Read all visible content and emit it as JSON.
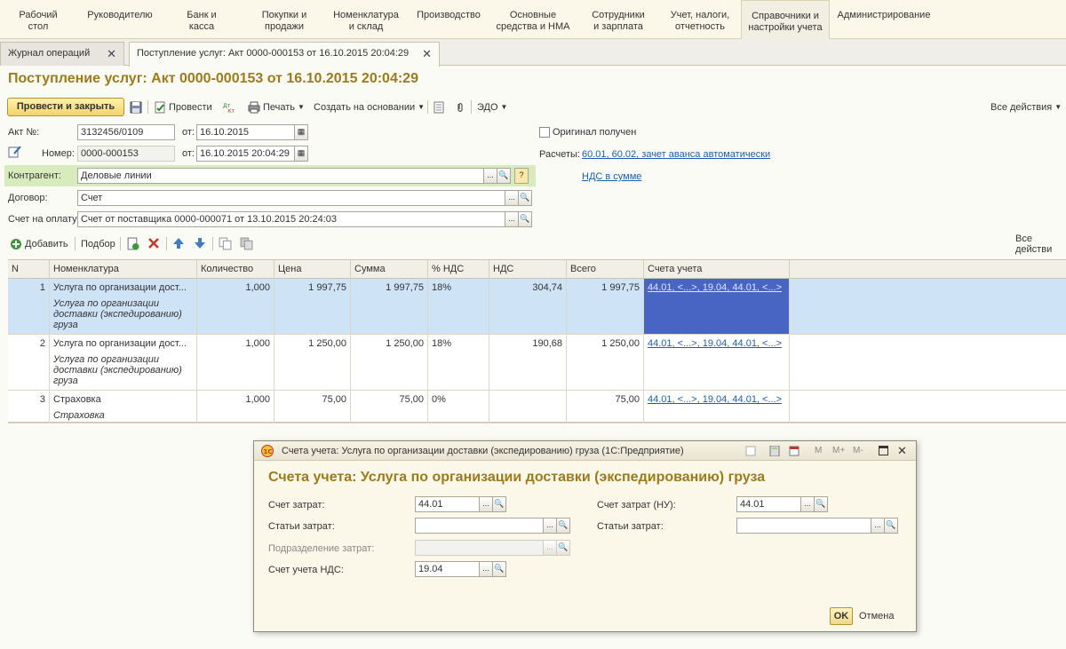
{
  "sections": [
    {
      "line1": "Рабочий",
      "line2": "стол"
    },
    {
      "line1": "Руководителю",
      "line2": ""
    },
    {
      "line1": "Банк и",
      "line2": "касса"
    },
    {
      "line1": "Покупки и",
      "line2": "продажи"
    },
    {
      "line1": "Номенклатура",
      "line2": "и склад"
    },
    {
      "line1": "Производство",
      "line2": ""
    },
    {
      "line1": "Основные",
      "line2": "средства и НМА"
    },
    {
      "line1": "Сотрудники",
      "line2": "и зарплата"
    },
    {
      "line1": "Учет, налоги,",
      "line2": "отчетность"
    },
    {
      "line1": "Справочники и",
      "line2": "настройки учета"
    },
    {
      "line1": "Администрирование",
      "line2": ""
    }
  ],
  "tabs": [
    {
      "label": "Журнал операций",
      "close": "✕"
    },
    {
      "label": "Поступление услуг: Акт 0000-000153 от 16.10.2015 20:04:29",
      "close": "✕"
    }
  ],
  "title": "Поступление услуг: Акт 0000-000153 от 16.10.2015 20:04:29",
  "toolbar": {
    "post_close": "Провести и закрыть",
    "post": "Провести",
    "print": "Печать",
    "create_based": "Создать на основании",
    "edo": "ЭДО",
    "all_actions": "Все действия"
  },
  "form": {
    "act_no_label": "Акт №:",
    "act_no_value": "3132456/0109",
    "from_label": "от:",
    "act_date": "16.10.2015",
    "number_label": "Номер:",
    "number_value": "0000-000153",
    "number_date": "16.10.2015 20:04:29",
    "original_label": "Оригинал получен",
    "payments_label": "Расчеты:",
    "payments_link": "60.01, 60.02, зачет аванса автоматически",
    "vat_link": "НДС в сумме",
    "counterparty_label": "Контрагент:",
    "counterparty_value": "Деловые линии",
    "contract_label": "Договор:",
    "contract_value": "Счет",
    "invoice_label": "Счет на оплату:",
    "invoice_value": "Счет от поставщика 0000-000071 от 13.10.2015 20:24:03",
    "help": "?"
  },
  "table_toolbar": {
    "add": "Добавить",
    "pick": "Подбор",
    "all_actions": "Все действи"
  },
  "table": {
    "headers": [
      "N",
      "Номенклатура",
      "Количество",
      "Цена",
      "Сумма",
      "% НДС",
      "НДС",
      "Всего",
      "Счета учета"
    ],
    "rows": [
      {
        "n": "1",
        "name": "Услуга по организации дост...",
        "sub": "Услуга по организации доставки (экспедированию) груза",
        "qty": "1,000",
        "price": "1 997,75",
        "sum": "1 997,75",
        "vat_rate": "18%",
        "vat": "304,74",
        "total": "1 997,75",
        "accounts": "44.01, <...>, 19.04, 44.01, <...>"
      },
      {
        "n": "2",
        "name": "Услуга по организации дост...",
        "sub": "Услуга по организации доставки (экспедированию) груза",
        "qty": "1,000",
        "price": "1 250,00",
        "sum": "1 250,00",
        "vat_rate": "18%",
        "vat": "190,68",
        "total": "1 250,00",
        "accounts": "44.01, <...>, 19.04, 44.01, <...>"
      },
      {
        "n": "3",
        "name": "Страховка",
        "sub": "Страховка",
        "qty": "1,000",
        "price": "75,00",
        "sum": "75,00",
        "vat_rate": "0%",
        "vat": "",
        "total": "75,00",
        "accounts": "44.01, <...>, 19.04, 44.01, <...>"
      }
    ]
  },
  "dialog": {
    "window_title": "Счета учета: Услуга по организации доставки (экспедированию) груза   (1С:Предприятие)",
    "heading": "Счета учета: Услуга по организации доставки (экспедированию) груза",
    "cost_account_label": "Счет затрат:",
    "cost_account_value": "44.01",
    "cost_items_label": "Статьи затрат:",
    "cost_items_value": "",
    "cost_dept_label": "Подразделение затрат:",
    "cost_dept_value": "",
    "vat_account_label": "Счет учета НДС:",
    "vat_account_value": "19.04",
    "cost_account_nu_label": "Счет затрат (НУ):",
    "cost_account_nu_value": "44.01",
    "cost_items_nu_label": "Статьи затрат:",
    "cost_items_nu_value": "",
    "ok": "OK",
    "cancel": "Отмена",
    "hdr_m": "M",
    "hdr_mplus": "M+",
    "hdr_mminus": "M-",
    "hdr_close": "✕"
  },
  "colors": {
    "accent_title": "#9c7b1b",
    "selection": "#cfe3f7",
    "selected_cell": "#4965c4",
    "counterparty_bg": "#d7ebbc"
  }
}
